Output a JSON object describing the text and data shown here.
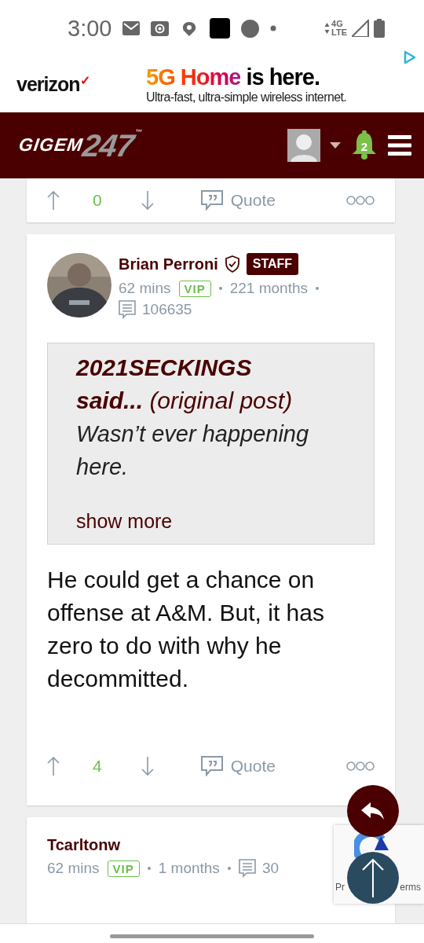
{
  "status_bar": {
    "time": "3:00",
    "network": "4G",
    "network_sub": "LTE"
  },
  "ad": {
    "brand": "verizon",
    "brand_mark": "✓",
    "headline_accent": "5G Home",
    "headline": "is here.",
    "subline": "Ultra-fast, ultra-simple wireless internet."
  },
  "header": {
    "logo_word": "GIGEM",
    "logo_number": "247",
    "logo_mark": "™",
    "notifications": "2"
  },
  "posts": [
    {
      "kind": "partial",
      "upvotes": "0",
      "quote": "Quote"
    },
    {
      "kind": "full",
      "author": "Brian Perroni",
      "role_badge": "STAFF",
      "verified": true,
      "time": "62 mins",
      "vip": "VIP",
      "tenure": "221 months",
      "post_count": "106635",
      "quoted": {
        "author": "2021SECKINGS",
        "said": "said...",
        "link": "(original post)",
        "text": "Wasn’t ever happening here.",
        "more": "show more"
      },
      "body": "He could get a chance on offense at A&M. But, it has zero to do with why he decommitted.",
      "upvotes": "4",
      "quote": "Quote"
    },
    {
      "kind": "header_only",
      "author": "Tcarltonw",
      "verified": false,
      "time": "62 mins",
      "vip": "VIP",
      "tenure": "1 months",
      "post_count": "30"
    }
  ],
  "recaptcha": {
    "left": "Pr",
    "right": "erms"
  }
}
